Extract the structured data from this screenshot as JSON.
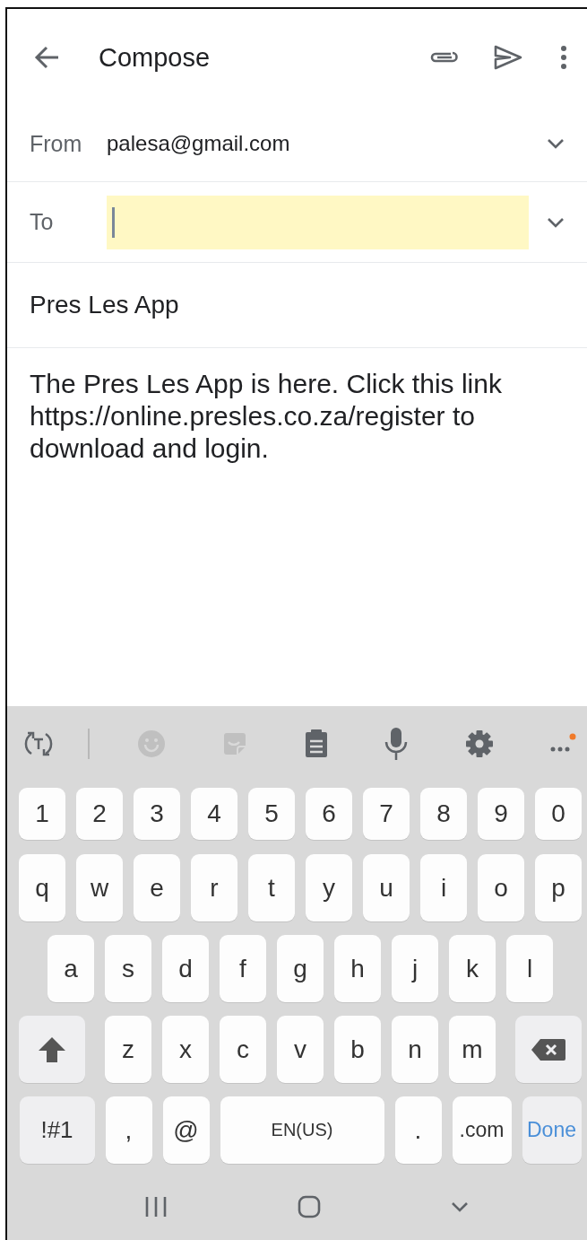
{
  "app_bar": {
    "title": "Compose"
  },
  "from": {
    "label": "From",
    "value": "palesa@gmail.com"
  },
  "to": {
    "label": "To",
    "focused": true
  },
  "subject": {
    "value": "Pres Les App"
  },
  "body": {
    "value": "The Pres Les App is here. Click this link https://online.presles.co.za/register to download and login."
  },
  "keyboard": {
    "toolbar": [
      {
        "kind": "translate",
        "disabled": false
      },
      {
        "kind": "emoji",
        "disabled": true
      },
      {
        "kind": "sticker",
        "disabled": true
      },
      {
        "kind": "clipboard",
        "disabled": false
      },
      {
        "kind": "voice",
        "disabled": false
      },
      {
        "kind": "settings",
        "disabled": false
      },
      {
        "kind": "more",
        "disabled": false,
        "notification": true
      }
    ],
    "rows": [
      {
        "keys": [
          {
            "kind": "digit",
            "label": "1"
          },
          {
            "kind": "digit",
            "label": "2"
          },
          {
            "kind": "digit",
            "label": "3"
          },
          {
            "kind": "digit",
            "label": "4"
          },
          {
            "kind": "digit",
            "label": "5"
          },
          {
            "kind": "digit",
            "label": "6"
          },
          {
            "kind": "digit",
            "label": "7"
          },
          {
            "kind": "digit",
            "label": "8"
          },
          {
            "kind": "digit",
            "label": "9"
          },
          {
            "kind": "digit",
            "label": "0"
          }
        ]
      },
      {
        "keys": [
          {
            "kind": "char",
            "label": "q"
          },
          {
            "kind": "char",
            "label": "w"
          },
          {
            "kind": "char",
            "label": "e"
          },
          {
            "kind": "char",
            "label": "r"
          },
          {
            "kind": "char",
            "label": "t"
          },
          {
            "kind": "char",
            "label": "y"
          },
          {
            "kind": "char",
            "label": "u"
          },
          {
            "kind": "char",
            "label": "i"
          },
          {
            "kind": "char",
            "label": "o"
          },
          {
            "kind": "char",
            "label": "p"
          }
        ]
      },
      {
        "keys": [
          {
            "kind": "char",
            "label": "a"
          },
          {
            "kind": "char",
            "label": "s"
          },
          {
            "kind": "char",
            "label": "d"
          },
          {
            "kind": "char",
            "label": "f"
          },
          {
            "kind": "char",
            "label": "g"
          },
          {
            "kind": "char",
            "label": "h"
          },
          {
            "kind": "char",
            "label": "j"
          },
          {
            "kind": "char",
            "label": "k"
          },
          {
            "kind": "char",
            "label": "l"
          }
        ]
      },
      {
        "keys": [
          {
            "kind": "shift"
          },
          {
            "kind": "char",
            "label": "z"
          },
          {
            "kind": "char",
            "label": "x"
          },
          {
            "kind": "char",
            "label": "c"
          },
          {
            "kind": "char",
            "label": "v"
          },
          {
            "kind": "char",
            "label": "b"
          },
          {
            "kind": "char",
            "label": "n"
          },
          {
            "kind": "char",
            "label": "m"
          },
          {
            "kind": "backspace"
          }
        ]
      },
      {
        "keys": [
          {
            "kind": "symbols",
            "label": "!#1"
          },
          {
            "kind": "char",
            "label": ","
          },
          {
            "kind": "char",
            "label": "@"
          },
          {
            "kind": "space",
            "label": "EN(US)"
          },
          {
            "kind": "char",
            "label": "."
          },
          {
            "kind": "dotcom",
            "label": ".com"
          },
          {
            "kind": "done",
            "label": "Done"
          }
        ]
      }
    ]
  }
}
